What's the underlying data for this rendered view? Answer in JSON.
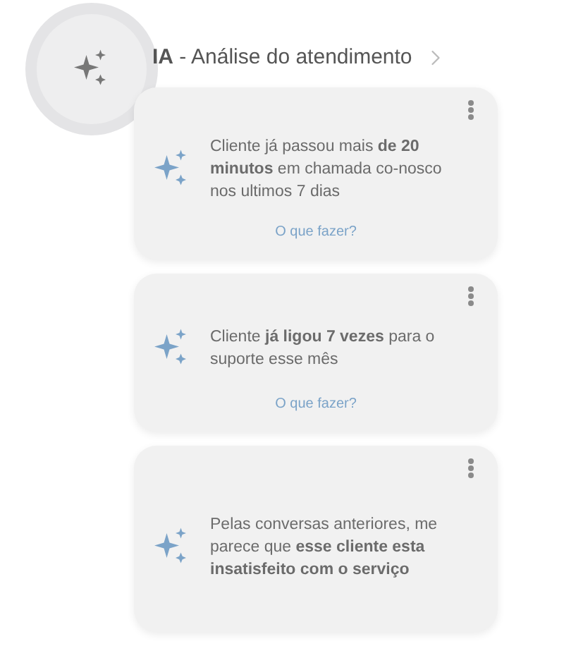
{
  "header": {
    "title": "**IA** - Análise do atendimento"
  },
  "cards": [
    {
      "text": "Cliente já passou mais **de 20 minutos** em chamada co-nosco nos ultimos 7 dias",
      "link": "O que fazer?"
    },
    {
      "text": "Cliente **já ligou 7 vezes** para o suporte esse mês",
      "link": "O que fazer?"
    },
    {
      "text": "Pelas conversas anteriores, me parece que **esse cliente esta insatisfeito com o serviço**"
    }
  ]
}
